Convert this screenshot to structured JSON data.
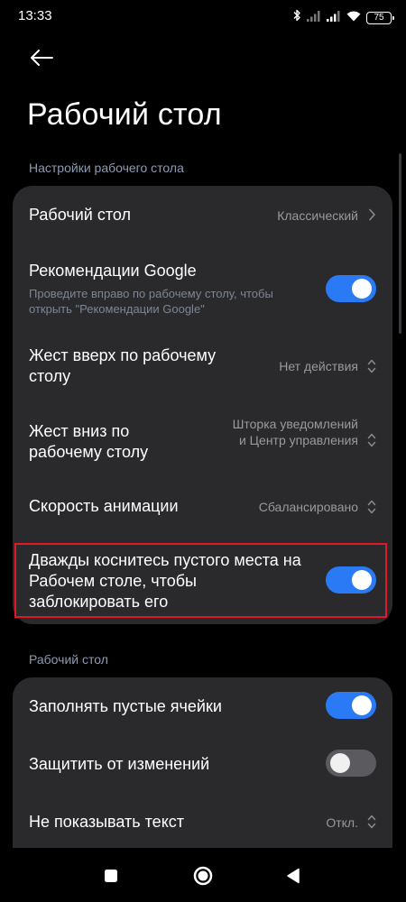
{
  "status_bar": {
    "time": "13:33",
    "battery": "75",
    "icons": [
      "bluetooth-icon",
      "signal-icon",
      "signal-icon",
      "wifi-icon",
      "battery-icon"
    ]
  },
  "header": {
    "title": "Рабочий стол"
  },
  "section1": {
    "header": "Настройки рабочего стола",
    "rows": [
      {
        "title": "Рабочий стол",
        "value": "Классический",
        "control": "chevron-right"
      },
      {
        "title": "Рекомендации Google",
        "subtitle": "Проведите вправо по рабочему столу, чтобы открыть \"Рекомендации Google\"",
        "control": "toggle",
        "state": "on"
      },
      {
        "title": "Жест вверх по рабочему столу",
        "value": "Нет действия",
        "control": "expand"
      },
      {
        "title": "Жест вниз по рабочему столу",
        "value": "Шторка уведомлений и Центр управления",
        "control": "expand"
      },
      {
        "title": "Скорость анимации",
        "value": "Сбалансировано",
        "control": "expand"
      },
      {
        "title": "Дважды коснитесь пустого места на Рабочем столе, чтобы заблокировать его",
        "control": "toggle",
        "state": "on"
      }
    ]
  },
  "section2": {
    "header": "Рабочий стол",
    "rows": [
      {
        "title": "Заполнять пустые ячейки",
        "control": "toggle",
        "state": "on"
      },
      {
        "title": "Защитить от изменений",
        "control": "toggle",
        "state": "off"
      },
      {
        "title": "Не показывать текст",
        "value": "Откл.",
        "control": "expand"
      }
    ]
  },
  "colors": {
    "background": "#000000",
    "card": "#2a2a2c",
    "accent": "#2a7af6",
    "highlight": "#e0192a",
    "section_header": "#8e9bb2"
  },
  "nav": {
    "buttons": [
      "recents-square-icon",
      "home-circle-icon",
      "back-triangle-icon"
    ]
  }
}
